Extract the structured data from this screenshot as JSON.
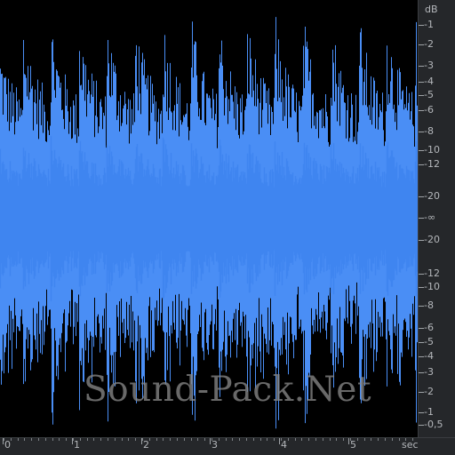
{
  "db_scale": {
    "unit": "dB",
    "labels": [
      "-1",
      "-2",
      "-3",
      "-4",
      "-5",
      "-6",
      "-8",
      "-10",
      "-12",
      "-20",
      "-∞",
      "-20",
      "-12",
      "-10",
      "-8",
      "-6",
      "-5",
      "-4",
      "-3",
      "-2",
      "-1",
      "-0,5"
    ]
  },
  "time_scale": {
    "unit": "sec",
    "labels": [
      "0",
      "1",
      "2",
      "3",
      "4",
      "5"
    ]
  },
  "watermark": "Sound-Pack.Net",
  "colors": {
    "waveform": "#4a8ef5",
    "background": "#000000",
    "ruler": "#25272a",
    "ruler_text": "#b4b7bb"
  }
}
